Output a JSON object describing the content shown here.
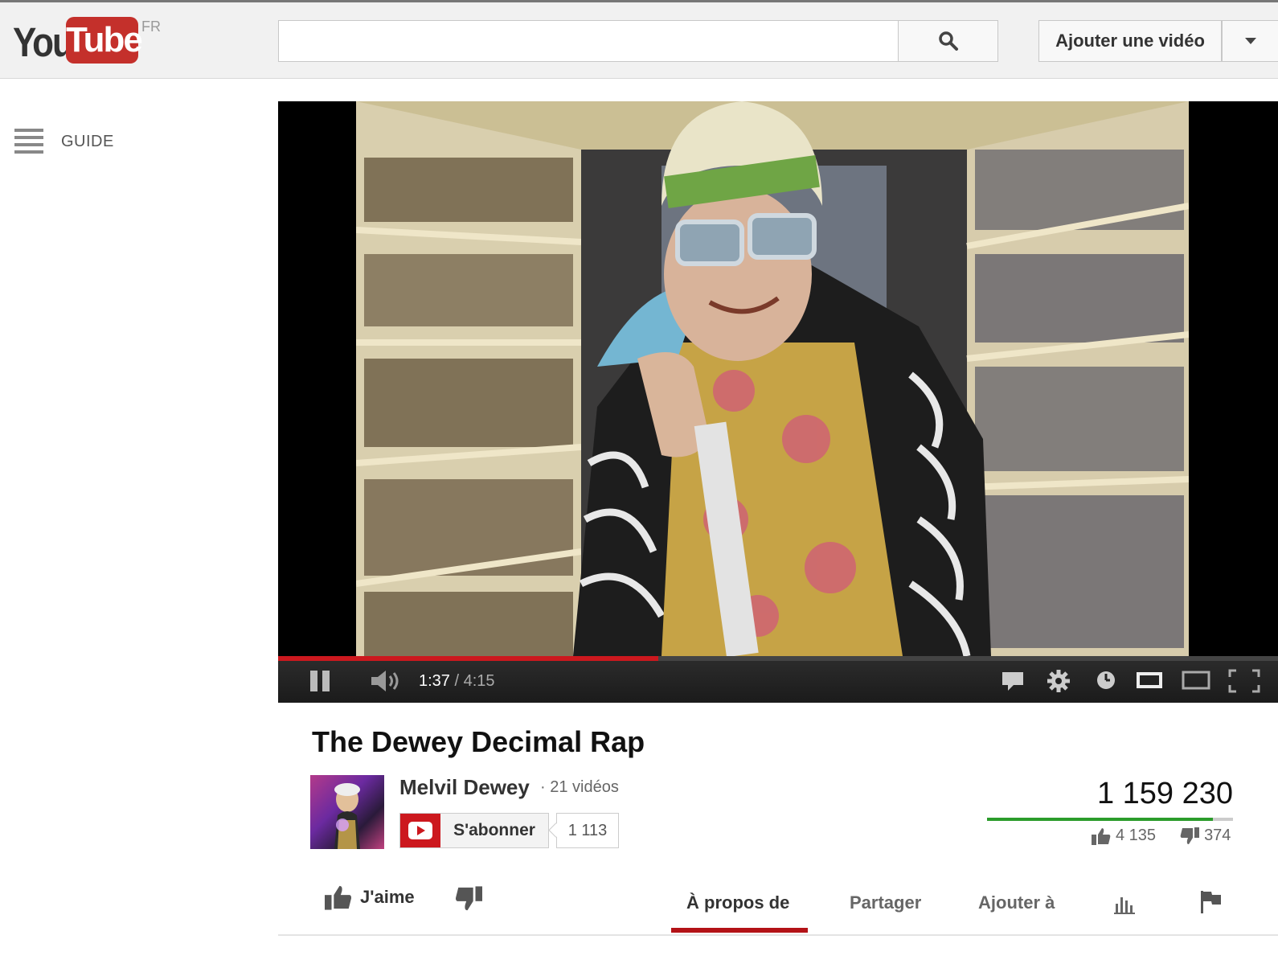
{
  "header": {
    "logo": {
      "you": "You",
      "tube": "Tube",
      "region": "FR"
    },
    "search": {
      "value": "",
      "placeholder": ""
    },
    "upload_label": "Ajouter une vidéo"
  },
  "guide": {
    "label": "GUIDE"
  },
  "player": {
    "current_time": "1:37",
    "separator": " / ",
    "duration": "4:15",
    "progress": 0.38
  },
  "video": {
    "title": "The Dewey Decimal Rap",
    "channel": "Melvil Dewey",
    "video_count": "· 21 vidéos",
    "subscribe_label": "S'abonner",
    "subscriber_count": "1 113",
    "views": "1 159 230",
    "likes": "4 135",
    "dislikes": "374",
    "like_ratio": 0.917
  },
  "actions": {
    "like_label": "J'aime",
    "tabs": [
      "À propos de",
      "Partager",
      "Ajouter à"
    ]
  },
  "colors": {
    "brand": "#c4302b",
    "progress": "#cc181e",
    "like_bar": "#2b9c2b"
  }
}
